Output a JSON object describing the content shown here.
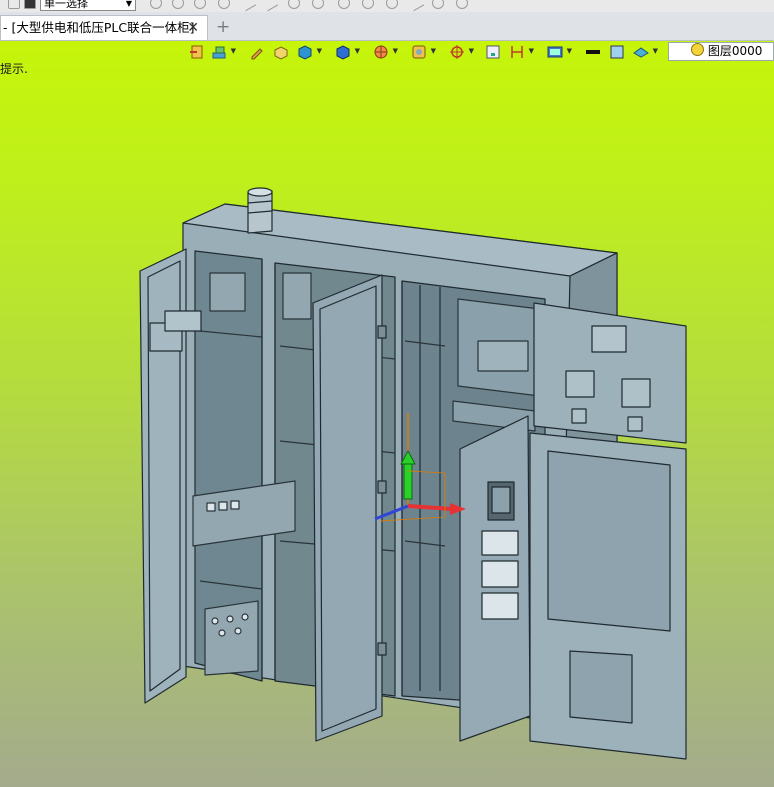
{
  "topbar": {
    "selection_mode": "单一选择"
  },
  "tab": {
    "title": "- [大型供电和低压PLC联合一体柜]",
    "close_glyph": "✕",
    "new_glyph": "+"
  },
  "viewport": {
    "hint": "提示.",
    "layer_name": "图层0000"
  },
  "colors": {
    "background_top": "#c6f50a",
    "background_bottom": "#a4ab8c",
    "model": "#8fa3ad"
  }
}
